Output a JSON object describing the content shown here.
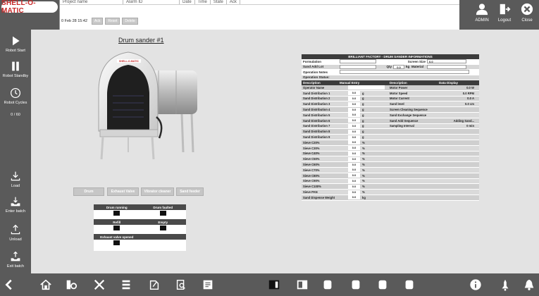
{
  "app": {
    "logo_text": "SHELL-O-MATIC"
  },
  "alarm_table": {
    "headers": [
      "Project name",
      "Alarm ID",
      "Date",
      "Time",
      "State",
      "Ack"
    ],
    "date_text": "0 Feb 28 15:42",
    "buttons": [
      "Ack",
      "Reset",
      "Delete"
    ]
  },
  "header_buttons": {
    "admin": "ADMIN",
    "logout": "Logout",
    "close": "Close"
  },
  "sidebar": {
    "items": [
      {
        "label": "Robot Start",
        "icon": "play-icon"
      },
      {
        "label": "Robot Standby",
        "icon": "pause-icon"
      },
      {
        "label": "Robot Cycles",
        "icon": "clock-icon"
      },
      {
        "label": "0 / 60",
        "icon": ""
      },
      {
        "label": "Load",
        "icon": "load-icon"
      },
      {
        "label": "Enter batch",
        "icon": "enter-batch-icon"
      },
      {
        "label": "Unload",
        "icon": "unload-icon"
      },
      {
        "label": "Exit batch",
        "icon": "exit-batch-icon"
      }
    ]
  },
  "main": {
    "title": "Drum sander #1",
    "machine_brand": "SHELL-O-MATIC",
    "function_buttons": [
      "Drum",
      "Exhaust Valve",
      "Vibrator cleaner",
      "Sand feeder"
    ]
  },
  "status_panel": {
    "row1": [
      "Drum running",
      "Drum faulted"
    ],
    "row2": [
      "Refill",
      "Empty"
    ],
    "row3": [
      "Exhaust valve opened"
    ]
  },
  "info_table": {
    "title": "BRILLIANT FACTORY - DRUM SANDER INFORMATIONS",
    "formulation_label": "Formulation",
    "screen_size_label": "Screen Size",
    "screen_size_value": "0.0",
    "sand_add_lot_label": "Sand Add Lot",
    "qty_label": "Qty",
    "qty_value": "0.0",
    "qty_unit": "kg",
    "material_label": "Material",
    "operation_notes_label": "Operation Notes",
    "operation_status_label": "Operation Status:",
    "col_headers": [
      "Description",
      "Manual Entry",
      "Description",
      "Data Display"
    ],
    "rows": [
      {
        "desc": "Operator Name",
        "val": "",
        "unit": "",
        "desc2": "Motor Power",
        "disp": "0.0 W"
      },
      {
        "desc": "Sand Distribution 1",
        "val": "0.0",
        "unit": "g",
        "desc2": "Motor Speed",
        "disp": "0.0 RPM"
      },
      {
        "desc": "Sand Distribution 2",
        "val": "0.0",
        "unit": "g",
        "desc2": "Motor Current",
        "disp": "0.0 A"
      },
      {
        "desc": "Sand Distribution 3",
        "val": "0.0",
        "unit": "g",
        "desc2": "Sand level",
        "disp": "0.0 cm"
      },
      {
        "desc": "Sand Distribution 4",
        "val": "0.0",
        "unit": "g",
        "desc2": "Screen Cleaning Sequence",
        "disp": ""
      },
      {
        "desc": "Sand Distribution 5",
        "val": "0.0",
        "unit": "g",
        "desc2": "Sand Exchange Sequence",
        "disp": ""
      },
      {
        "desc": "Sand Distribution 6",
        "val": "0.0",
        "unit": "g",
        "desc2": "Sand Add Sequence",
        "disp": "Adding Sand..."
      },
      {
        "desc": "Sand Distribution 7",
        "val": "0.0",
        "unit": "g",
        "desc2": "Sampling Interval",
        "disp": "0 min"
      },
      {
        "desc": "Sand Distribution 8",
        "val": "0.0",
        "unit": "g",
        "desc2": "",
        "disp": ""
      },
      {
        "desc": "Sand Distribution 9",
        "val": "0.0",
        "unit": "g",
        "desc2": "",
        "disp": ""
      },
      {
        "desc": "Sieve C20%",
        "val": "0.0",
        "unit": "%",
        "desc2": "",
        "disp": ""
      },
      {
        "desc": "Sieve C30%",
        "val": "0.0",
        "unit": "%",
        "desc2": "",
        "disp": ""
      },
      {
        "desc": "Sieve C40%",
        "val": "0.0",
        "unit": "%",
        "desc2": "",
        "disp": ""
      },
      {
        "desc": "Sieve C50%",
        "val": "0.0",
        "unit": "%",
        "desc2": "",
        "disp": ""
      },
      {
        "desc": "Sieve C60%",
        "val": "0.0",
        "unit": "%",
        "desc2": "",
        "disp": ""
      },
      {
        "desc": "Sieve C70%",
        "val": "0.0",
        "unit": "%",
        "desc2": "",
        "disp": ""
      },
      {
        "desc": "Sieve C80%",
        "val": "0.0",
        "unit": "%",
        "desc2": "",
        "disp": ""
      },
      {
        "desc": "Sieve C90%",
        "val": "0.0",
        "unit": "%",
        "desc2": "",
        "disp": ""
      },
      {
        "desc": "Sieve C100%",
        "val": "0.0",
        "unit": "%",
        "desc2": "",
        "disp": ""
      },
      {
        "desc": "Sieve PAN",
        "val": "0.0",
        "unit": "%",
        "desc2": "",
        "disp": ""
      },
      {
        "desc": "Sand Dispense Weight",
        "val": "0.0",
        "unit": "kg",
        "desc2": "",
        "disp": ""
      }
    ]
  },
  "bottom_bar": {
    "icons": [
      "back-icon",
      "home-icon",
      "settings-icon",
      "tools-icon",
      "list-icon",
      "edit-icon",
      "search-doc-icon",
      "report-icon",
      "panel-active-icon",
      "panel-icon",
      "drum-1-icon",
      "drum-2-icon",
      "drum-3-icon",
      "drum-4-icon",
      "info-icon",
      "alarm-icon",
      "bell-icon"
    ]
  },
  "colors": {
    "bar": "#5a5a5a",
    "brand_red": "#c62828",
    "background": "#e3e3e3",
    "table_header": "#3c3c3c"
  }
}
